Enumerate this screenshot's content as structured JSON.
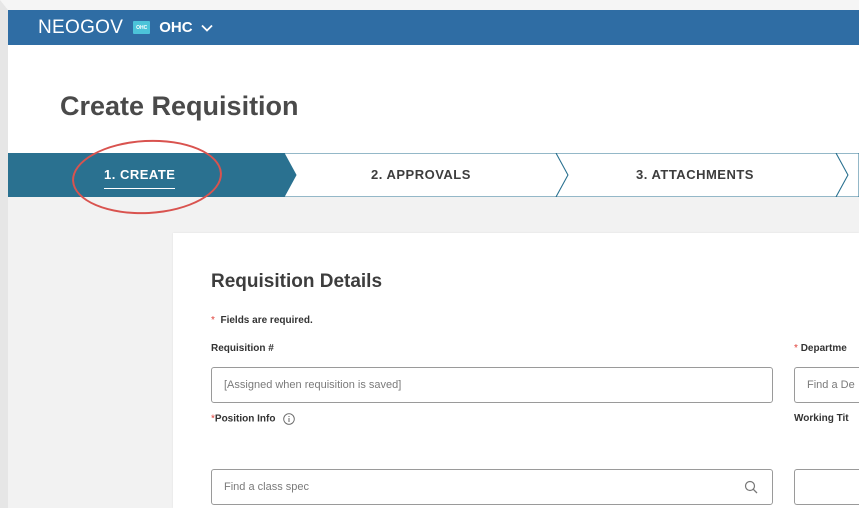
{
  "topbar": {
    "brand": "NEOGOV",
    "org_badge": "OHC",
    "org_name": "OHC"
  },
  "page": {
    "title": "Create Requisition"
  },
  "steps": [
    {
      "label": "1. CREATE",
      "active": true
    },
    {
      "label": "2. APPROVALS",
      "active": false
    },
    {
      "label": "3. ATTACHMENTS",
      "active": false
    }
  ],
  "form": {
    "section_title": "Requisition Details",
    "required_marker": "*",
    "required_note": "Fields are required.",
    "requisition_label": "Requisition #",
    "requisition_value": "[Assigned when requisition is saved]",
    "department_label": "Departme",
    "department_placeholder": "Find a De",
    "position_label": "Position Info",
    "position_placeholder": "Find a class spec",
    "working_title_label": "Working Tit"
  },
  "colors": {
    "topbar": "#2f6da4",
    "active_step": "#2a7190",
    "required": "#e0413a",
    "highlight_circle": "#d9534f"
  },
  "icons": [
    "chevron-down-icon",
    "info-icon",
    "search-icon"
  ]
}
